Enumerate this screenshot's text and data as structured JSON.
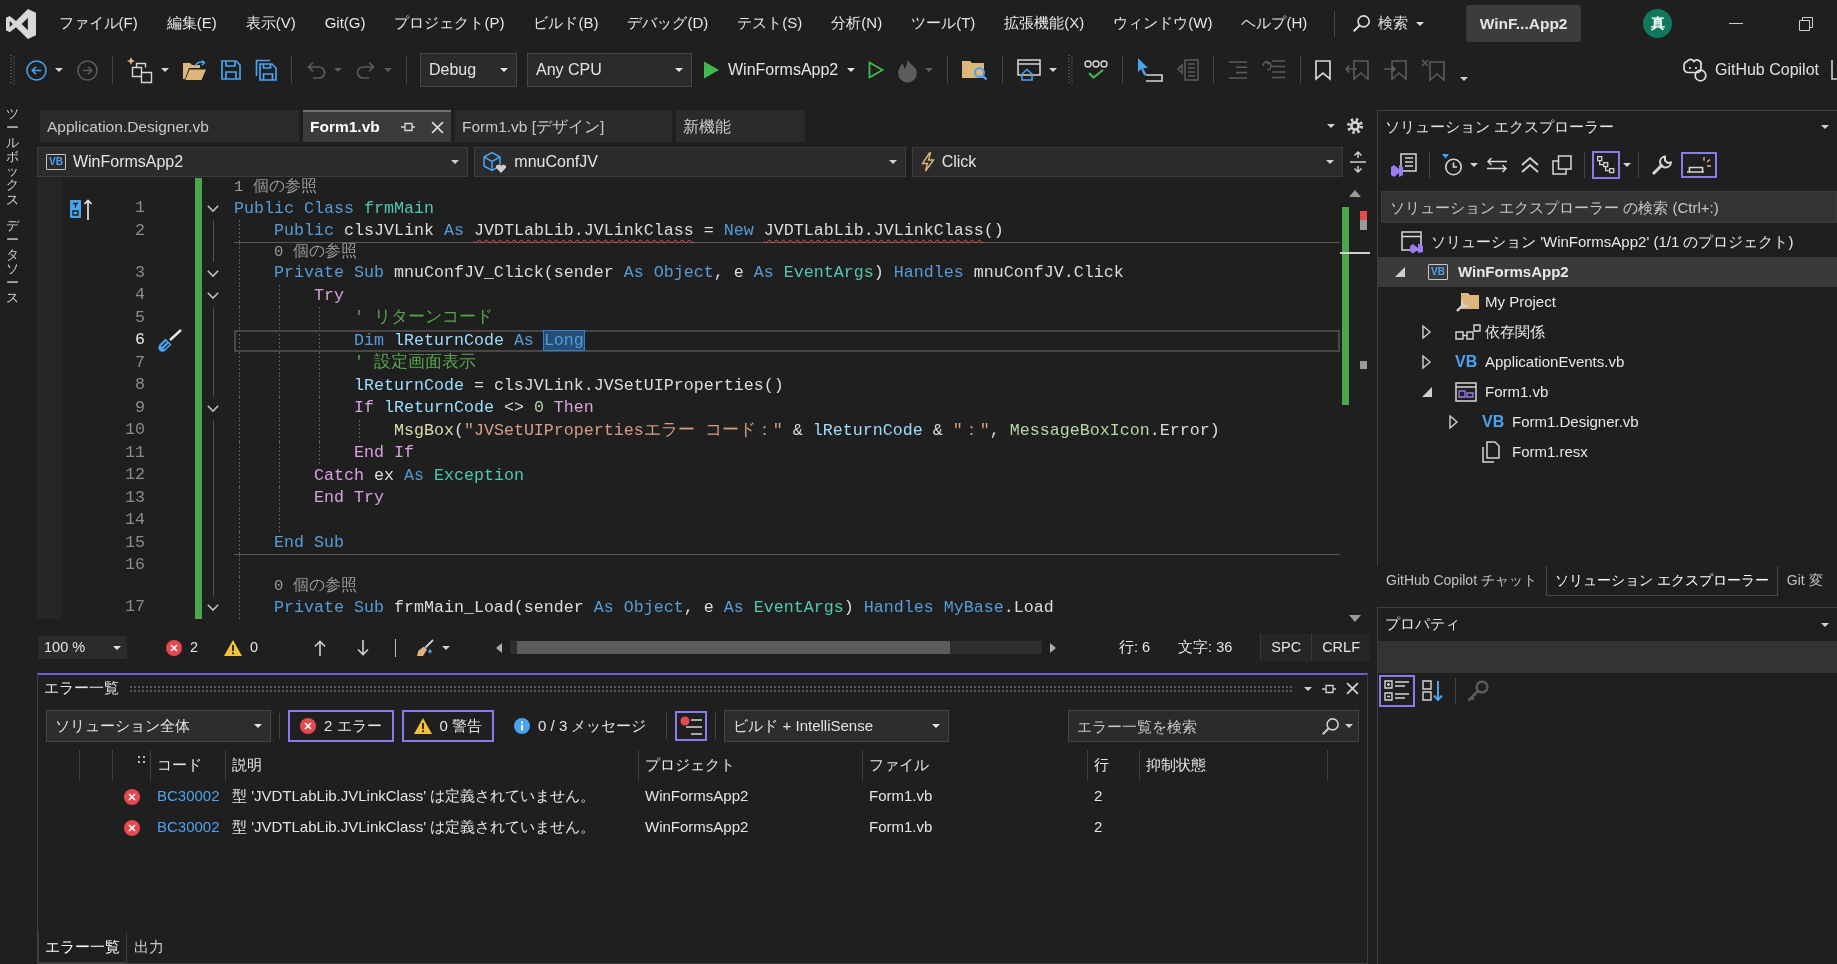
{
  "side_tabs": [
    "ツールボックス",
    "データソース"
  ],
  "menu_bar": {
    "menus": [
      "ファイル(F)",
      "編集(E)",
      "表示(V)",
      "Git(G)",
      "プロジェクト(P)",
      "ビルド(B)",
      "デバッグ(D)",
      "テスト(S)",
      "分析(N)",
      "ツール(T)",
      "拡張機能(X)",
      "ウィンドウ(W)",
      "ヘルプ(H)"
    ],
    "search_label": "検索",
    "window_title": "WinF...App2",
    "account_initial": "真"
  },
  "toolbar": {
    "items": [
      {
        "kind": "grip"
      },
      {
        "kind": "back",
        "disabled": false,
        "menu": true
      },
      {
        "kind": "forward",
        "disabled": true
      },
      {
        "kind": "separator"
      },
      {
        "kind": "new-project",
        "disabled": false,
        "menu": true
      },
      {
        "kind": "open",
        "disabled": false
      },
      {
        "kind": "save",
        "disabled": false
      },
      {
        "kind": "save-all",
        "disabled": false
      },
      {
        "kind": "separator"
      },
      {
        "kind": "undo",
        "disabled": true,
        "menu": true
      },
      {
        "kind": "redo",
        "disabled": true,
        "menu": true
      },
      {
        "kind": "separator"
      },
      {
        "kind": "configuration",
        "value": "Debug"
      },
      {
        "kind": "platform",
        "value": "Any CPU"
      },
      {
        "kind": "start",
        "label": "WinFormsApp2",
        "menu": true
      },
      {
        "kind": "run",
        "disabled": false
      },
      {
        "kind": "hot-reload",
        "disabled": true,
        "menu": true
      },
      {
        "kind": "separator"
      },
      {
        "kind": "find-folder",
        "disabled": false
      },
      {
        "kind": "separator"
      },
      {
        "kind": "browser",
        "disabled": false,
        "menu": true
      },
      {
        "kind": "grip"
      },
      {
        "kind": "spell-check",
        "disabled": false
      },
      {
        "kind": "separator"
      },
      {
        "kind": "pointer",
        "disabled": false
      },
      {
        "kind": "page",
        "disabled": true
      },
      {
        "kind": "separator"
      },
      {
        "kind": "outdent",
        "disabled": true
      },
      {
        "kind": "comment",
        "disabled": true
      },
      {
        "kind": "separator"
      },
      {
        "kind": "bookmark",
        "disabled": false
      },
      {
        "kind": "prev-bookmark",
        "disabled": true
      },
      {
        "kind": "next-bookmark",
        "disabled": true
      },
      {
        "kind": "clear-bookmarks",
        "disabled": true
      },
      {
        "kind": "overflow"
      }
    ],
    "copilot_label": "GitHub Copilot"
  },
  "editor": {
    "tabs": [
      {
        "label": "Application.Designer.vb",
        "selected": false
      },
      {
        "label": "Form1.vb",
        "selected": true
      },
      {
        "label": "Form1.vb [デザイン]",
        "selected": false
      },
      {
        "label": "新機能",
        "selected": false
      }
    ],
    "navigation": [
      {
        "kind": "project",
        "icon_text": "VB",
        "value": "WinFormsApp2"
      },
      {
        "kind": "member",
        "value": "mnuConfJV"
      },
      {
        "kind": "event",
        "value": "Click"
      }
    ],
    "lines": [
      {
        "kind": "references",
        "text": "1 個の参照"
      },
      {
        "kind": "code",
        "number": "1",
        "current": false,
        "expanded": true,
        "margin_icon": {
          "kind": "inheritance"
        },
        "tokens": [
          {
            "text": "Public Class ",
            "kind": "keyword"
          },
          {
            "text": "frmMain",
            "kind": "type"
          }
        ]
      },
      {
        "kind": "code",
        "number": "2",
        "current": false,
        "divider": true,
        "tokens": [
          {
            "text": "    Public",
            "kind": "keyword"
          },
          {
            "text": " clsJVLink ",
            "kind": "plain"
          },
          {
            "text": "As ",
            "kind": "keyword"
          },
          {
            "text": "JVDTLabLib.JVLinkClass",
            "kind": "error"
          },
          {
            "text": " = ",
            "kind": "plain"
          },
          {
            "text": "New ",
            "kind": "keyword"
          },
          {
            "text": "JVDTLabLib.JVLinkClass",
            "kind": "error"
          },
          {
            "text": "()",
            "kind": "plain"
          }
        ]
      },
      {
        "kind": "references",
        "text": "0 個の参照"
      },
      {
        "kind": "code",
        "number": "3",
        "current": false,
        "expanded": true,
        "tokens": [
          {
            "text": "    Private Sub",
            "kind": "keyword"
          },
          {
            "text": " mnuConfJV_Click(sender ",
            "kind": "plain"
          },
          {
            "text": "As Object",
            "kind": "keyword"
          },
          {
            "text": ", e ",
            "kind": "plain"
          },
          {
            "text": "As ",
            "kind": "keyword"
          },
          {
            "text": "EventArgs",
            "kind": "type"
          },
          {
            "text": ") ",
            "kind": "plain"
          },
          {
            "text": "Handles",
            "kind": "keyword"
          },
          {
            "text": " mnuConfJV.Click",
            "kind": "plain"
          }
        ]
      },
      {
        "kind": "code",
        "number": "4",
        "current": false,
        "expanded": true,
        "tokens": [
          {
            "text": "        Try",
            "kind": "control"
          }
        ]
      },
      {
        "kind": "code",
        "number": "5",
        "current": false,
        "tokens": [
          {
            "text": "            ' リターンコード",
            "kind": "comment"
          }
        ]
      },
      {
        "kind": "code",
        "number": "6",
        "current": true,
        "margin_icon": {
          "kind": "quick-actions"
        },
        "tokens": [
          {
            "text": "            Dim ",
            "kind": "keyword"
          },
          {
            "text": "lReturnCode ",
            "kind": "variable"
          },
          {
            "text": "As ",
            "kind": "keyword"
          },
          {
            "text": "Long",
            "kind": "selection"
          }
        ]
      },
      {
        "kind": "code",
        "number": "7",
        "current": false,
        "tokens": [
          {
            "text": "            ' 設定画面表示",
            "kind": "comment"
          }
        ]
      },
      {
        "kind": "code",
        "number": "8",
        "current": false,
        "tokens": [
          {
            "text": "            lReturnCode",
            "kind": "variable"
          },
          {
            "text": " = clsJVLink.JVSetUIProperties()",
            "kind": "plain"
          }
        ]
      },
      {
        "kind": "code",
        "number": "9",
        "current": false,
        "expanded": true,
        "tokens": [
          {
            "text": "            If ",
            "kind": "control"
          },
          {
            "text": "lReturnCode",
            "kind": "variable"
          },
          {
            "text": " <> ",
            "kind": "plain"
          },
          {
            "text": "0",
            "kind": "number"
          },
          {
            "text": " Then",
            "kind": "control"
          }
        ]
      },
      {
        "kind": "code",
        "number": "10",
        "current": false,
        "tokens": [
          {
            "text": "                MsgBox",
            "kind": "method"
          },
          {
            "text": "(",
            "kind": "plain"
          },
          {
            "text": "\"JVSetUIPropertiesエラー コード：\"",
            "kind": "string"
          },
          {
            "text": " & ",
            "kind": "plain"
          },
          {
            "text": "lReturnCode",
            "kind": "variable"
          },
          {
            "text": " & ",
            "kind": "plain"
          },
          {
            "text": "\"：\"",
            "kind": "string"
          },
          {
            "text": ", ",
            "kind": "plain"
          },
          {
            "text": "MessageBoxIcon",
            "kind": "enum"
          },
          {
            "text": ".Error)",
            "kind": "plain"
          }
        ]
      },
      {
        "kind": "code",
        "number": "11",
        "current": false,
        "tokens": [
          {
            "text": "            End If",
            "kind": "control"
          }
        ]
      },
      {
        "kind": "code",
        "number": "12",
        "current": false,
        "tokens": [
          {
            "text": "        Catch",
            "kind": "control"
          },
          {
            "text": " ex ",
            "kind": "plain"
          },
          {
            "text": "As ",
            "kind": "keyword"
          },
          {
            "text": "Exception",
            "kind": "type"
          }
        ]
      },
      {
        "kind": "code",
        "number": "13",
        "current": false,
        "tokens": [
          {
            "text": "        End Try",
            "kind": "control"
          }
        ]
      },
      {
        "kind": "code",
        "number": "14",
        "current": false
      },
      {
        "kind": "code",
        "number": "15",
        "current": false,
        "divider": true,
        "tokens": [
          {
            "text": "    End Sub",
            "kind": "keyword"
          }
        ]
      },
      {
        "kind": "code",
        "number": "16",
        "current": false
      },
      {
        "kind": "references",
        "text": "0 個の参照"
      },
      {
        "kind": "code",
        "number": "17",
        "current": false,
        "expanded": true,
        "tokens": [
          {
            "text": "    Private Sub",
            "kind": "keyword"
          },
          {
            "text": " frmMain_Load(sender ",
            "kind": "plain"
          },
          {
            "text": "As Object",
            "kind": "keyword"
          },
          {
            "text": ", e ",
            "kind": "plain"
          },
          {
            "text": "As ",
            "kind": "keyword"
          },
          {
            "text": "EventArgs",
            "kind": "type"
          },
          {
            "text": ") ",
            "kind": "plain"
          },
          {
            "text": "Handles MyBase",
            "kind": "keyword"
          },
          {
            "text": ".Load",
            "kind": "plain"
          }
        ]
      }
    ],
    "status": {
      "zoom": "100 %",
      "errors": "2",
      "warnings": "0",
      "line": "行: 6",
      "column": "文字: 36",
      "whitespace": "SPC",
      "line_ending": "CRLF"
    }
  },
  "error_list": {
    "title": "エラー一覧",
    "scope": "ソリューション全体",
    "filters": [
      {
        "kind": "errors",
        "label": "2 エラー",
        "selected": true
      },
      {
        "kind": "warnings",
        "label": "0 警告",
        "selected": true
      },
      {
        "kind": "messages",
        "label": "0 / 3 メッセージ",
        "selected": false
      },
      {
        "kind": "filter",
        "selected": true
      }
    ],
    "source": "ビルド + IntelliSense",
    "search_placeholder": "エラー一覧を検索",
    "columns": [
      "コード",
      "説明",
      "プロジェクト",
      "ファイル",
      "行",
      "抑制状態"
    ],
    "rows": [
      {
        "kind": "error",
        "code": "BC30002",
        "description": "型 'JVDTLabLib.JVLinkClass' は定義されていません。",
        "project": "WinFormsApp2",
        "file": "Form1.vb",
        "line": "2"
      },
      {
        "kind": "error",
        "code": "BC30002",
        "description": "型 'JVDTLabLib.JVLinkClass' は定義されていません。",
        "project": "WinFormsApp2",
        "file": "Form1.vb",
        "line": "2"
      }
    ],
    "tabs": [
      {
        "label": "エラー一覧",
        "selected": true
      },
      {
        "label": "出力",
        "selected": false
      }
    ]
  },
  "solution_explorer": {
    "title": "ソリューション エクスプローラー",
    "toolbar": [
      {
        "kind": "switch-views",
        "selected": false
      },
      {
        "kind": "separator"
      },
      {
        "kind": "pending-changes",
        "selected": false,
        "menu": true
      },
      {
        "kind": "sync",
        "selected": false
      },
      {
        "kind": "collapse",
        "selected": false
      },
      {
        "kind": "show-all",
        "selected": false
      },
      {
        "kind": "separator"
      },
      {
        "kind": "view",
        "selected": true,
        "menu": true
      },
      {
        "kind": "separator"
      },
      {
        "kind": "properties",
        "selected": false
      },
      {
        "kind": "preview",
        "selected": true
      }
    ],
    "search_placeholder": "ソリューション エクスプローラー の検索 (Ctrl+:)",
    "tree": [
      {
        "kind": "solution",
        "label": "ソリューション 'WinFormsApp2' (1/1 のプロジェクト)",
        "selected": false,
        "children": [
          {
            "kind": "project",
            "icon_text": "VB",
            "label": "WinFormsApp2",
            "selected": true,
            "startup": true,
            "expanded": true,
            "children": [
              {
                "kind": "my-project",
                "label": "My Project",
                "selected": false
              },
              {
                "kind": "dependencies",
                "label": "依存関係",
                "selected": false,
                "expanded": false
              },
              {
                "kind": "vb",
                "icon_text": "VB",
                "label": "ApplicationEvents.vb",
                "selected": false,
                "expanded": false
              },
              {
                "kind": "form",
                "label": "Form1.vb",
                "selected": false,
                "expanded": true,
                "children": [
                  {
                    "kind": "vb",
                    "icon_text": "VB",
                    "label": "Form1.Designer.vb",
                    "selected": false,
                    "expanded": false
                  },
                  {
                    "kind": "resource",
                    "label": "Form1.resx",
                    "selected": false
                  }
                ]
              }
            ]
          }
        ]
      }
    ],
    "tabs": [
      {
        "label": "GitHub Copilot チャット",
        "selected": false
      },
      {
        "label": "ソリューション エクスプローラー",
        "selected": true
      },
      {
        "label": "Git 変",
        "selected": false
      }
    ]
  },
  "properties": {
    "title": "プロパティ",
    "toolbar": [
      {
        "kind": "categorized",
        "selected": true,
        "disabled": false
      },
      {
        "kind": "alphabetical",
        "selected": false,
        "disabled": false
      },
      {
        "kind": "separator"
      },
      {
        "kind": "property-pages",
        "selected": false,
        "disabled": true
      }
    ]
  }
}
